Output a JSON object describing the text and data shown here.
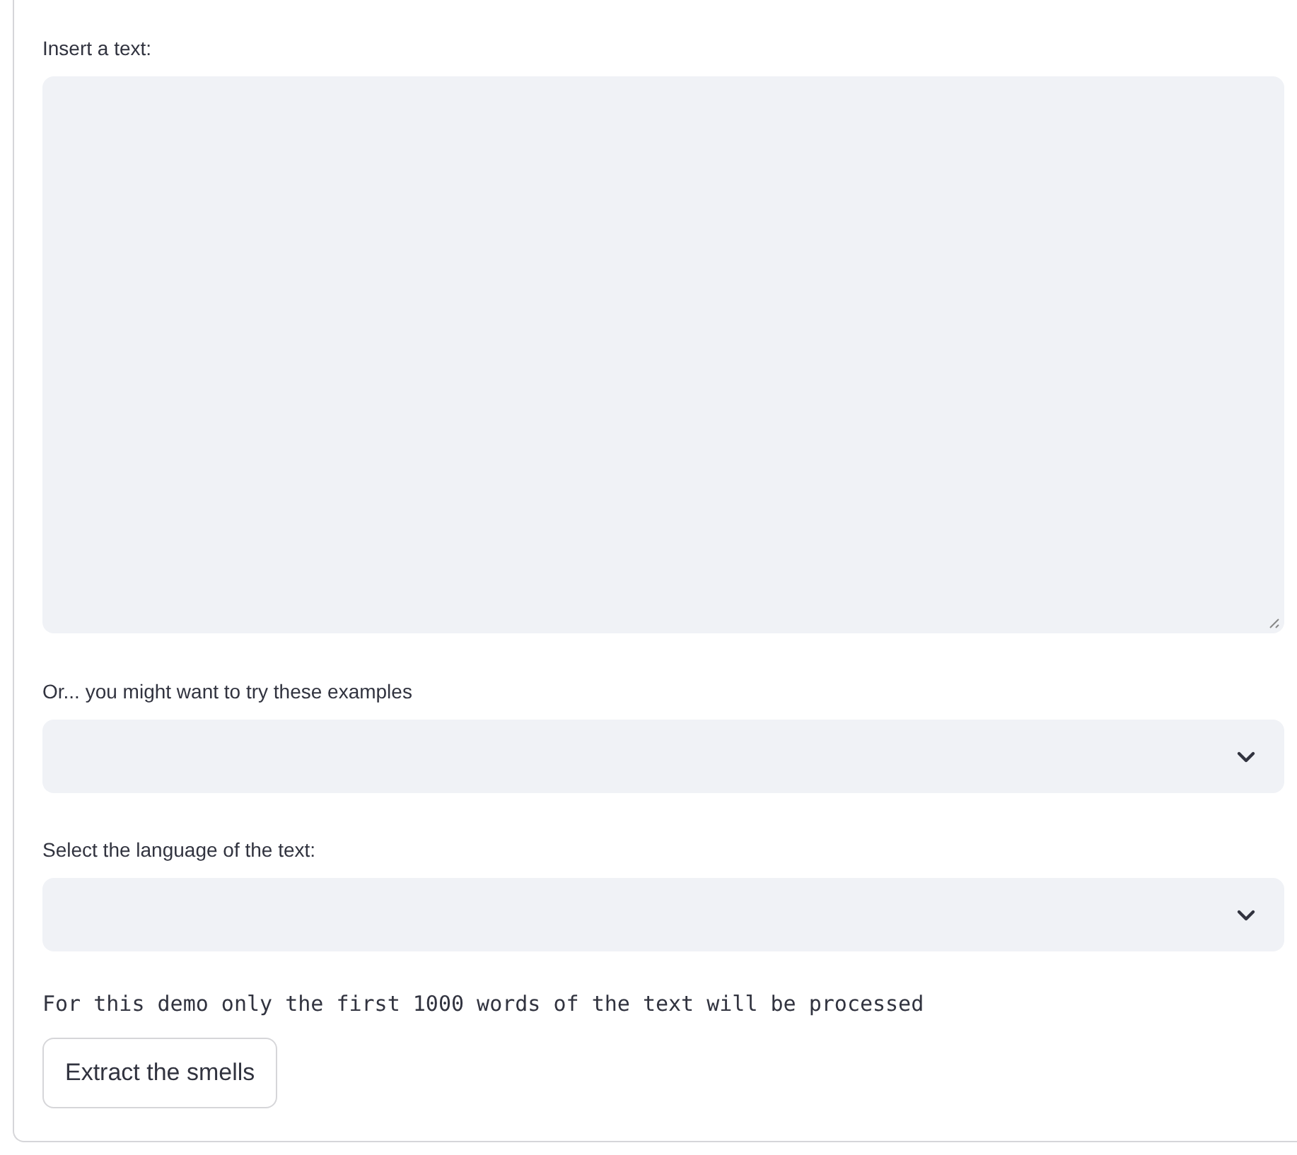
{
  "text_input": {
    "label": "Insert a text:"
  },
  "examples_select": {
    "label": "Or... you might want to try these examples"
  },
  "language_select": {
    "label": "Select the language of the text:"
  },
  "notice": "For this demo only the first 1000 words of the text will be processed",
  "button": {
    "label": "Extract the smells"
  }
}
